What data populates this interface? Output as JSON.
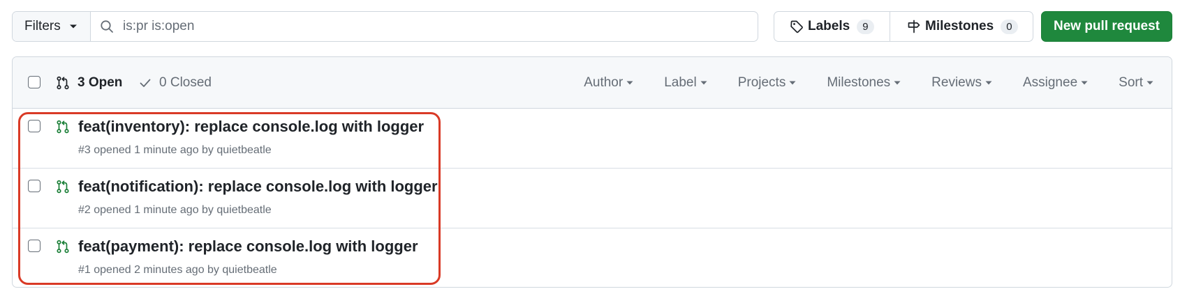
{
  "toolbar": {
    "filters_label": "Filters",
    "search_value": "is:pr is:open",
    "labels_label": "Labels",
    "labels_count": "9",
    "milestones_label": "Milestones",
    "milestones_count": "0",
    "new_pr_label": "New pull request"
  },
  "header": {
    "open_label": "3 Open",
    "closed_label": "0 Closed",
    "menus": [
      "Author",
      "Label",
      "Projects",
      "Milestones",
      "Reviews",
      "Assignee",
      "Sort"
    ]
  },
  "pull_requests": [
    {
      "title": "feat(inventory): replace console.log with logger",
      "meta": "#3 opened 1 minute ago by quietbeatle"
    },
    {
      "title": "feat(notification): replace console.log with logger",
      "meta": "#2 opened 1 minute ago by quietbeatle"
    },
    {
      "title": "feat(payment): replace console.log with logger",
      "meta": "#1 opened 2 minutes ago by quietbeatle"
    }
  ],
  "colors": {
    "primary_button": "#1f883d",
    "open_icon": "#1a7f37",
    "highlight": "#d93a26",
    "border": "#d0d7de",
    "muted_text": "#656d76"
  },
  "icons": {
    "search": "search-icon",
    "tag": "tag-icon",
    "milestone": "milestone-icon",
    "pull_request": "git-pull-request-icon",
    "check": "check-icon",
    "caret": "caret-down-icon"
  }
}
